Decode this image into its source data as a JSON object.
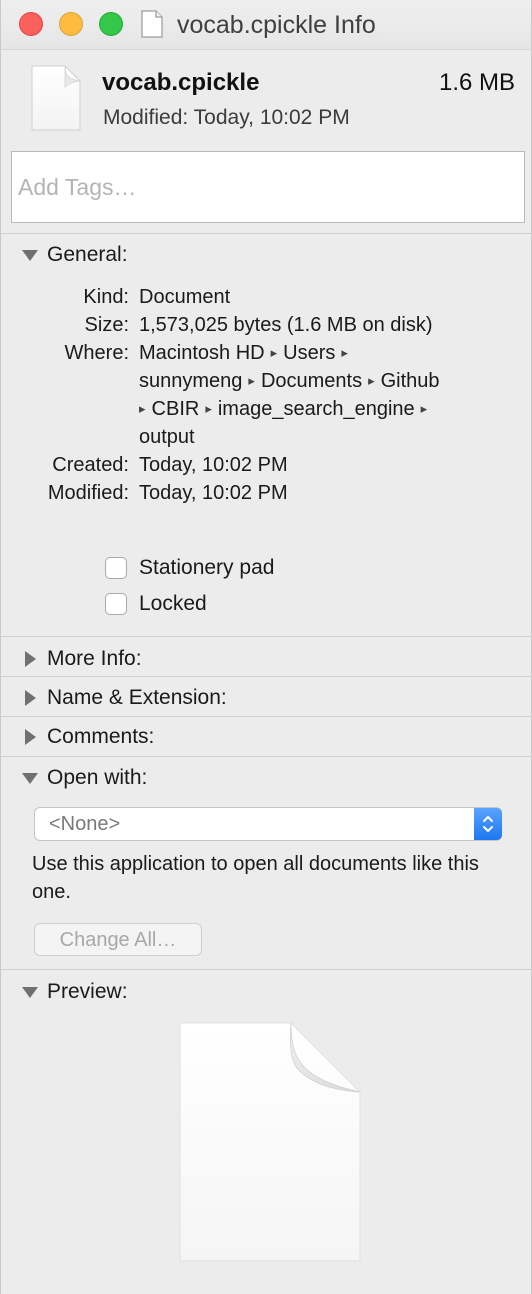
{
  "window": {
    "title": "vocab.cpickle Info"
  },
  "file": {
    "name": "vocab.cpickle",
    "size": "1.6 MB",
    "modified": "Modified: Today, 10:02 PM"
  },
  "tags": {
    "placeholder": "Add Tags…",
    "value": ""
  },
  "sections": {
    "general": {
      "label": "General:",
      "expanded": true
    },
    "more_info": {
      "label": "More Info:",
      "expanded": false
    },
    "name_extension": {
      "label": "Name & Extension:",
      "expanded": false
    },
    "comments": {
      "label": "Comments:",
      "expanded": false
    },
    "open_with": {
      "label": "Open with:",
      "expanded": true
    },
    "preview": {
      "label": "Preview:",
      "expanded": true
    }
  },
  "general": {
    "kind_label": "Kind:",
    "kind_value": "Document",
    "size_label": "Size:",
    "size_value": "1,573,025 bytes (1.6 MB on disk)",
    "where_label": "Where:",
    "where_path": [
      "Macintosh HD",
      "Users",
      "sunnymeng",
      "Documents",
      "Github",
      "CBIR",
      "image_search_engine",
      "output"
    ],
    "path_separator": "▸",
    "created_label": "Created:",
    "created_value": "Today, 10:02 PM",
    "modified_label": "Modified:",
    "modified_value": "Today, 10:02 PM",
    "stationery_label": "Stationery pad",
    "stationery_checked": false,
    "locked_label": "Locked",
    "locked_checked": false
  },
  "open_with": {
    "selected": "<None>",
    "description": "Use this application to open all documents like this one.",
    "change_all_label": "Change All…"
  },
  "colors": {
    "close": "#fc605c",
    "minimize": "#fdbc40",
    "zoom": "#34c84a",
    "popup_accent": "#1c78f2"
  },
  "icons": {
    "title_icon": "document-icon",
    "header_icon": "document-icon",
    "preview_icon": "document-icon"
  }
}
